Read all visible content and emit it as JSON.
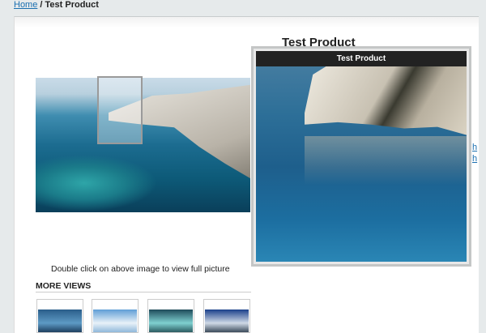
{
  "breadcrumb": {
    "home": "Home",
    "separator": " / ",
    "current": "Test Product"
  },
  "product": {
    "title": "Test Product",
    "caption": "Double click on above image to view  full picture"
  },
  "zoom": {
    "header": "Test Product"
  },
  "side_links": [
    "h",
    "h"
  ],
  "more_views": {
    "heading": "MORE VIEWS",
    "thumbnails": [
      {
        "name": "thumb-1"
      },
      {
        "name": "thumb-2"
      },
      {
        "name": "thumb-3"
      },
      {
        "name": "thumb-4"
      }
    ]
  }
}
